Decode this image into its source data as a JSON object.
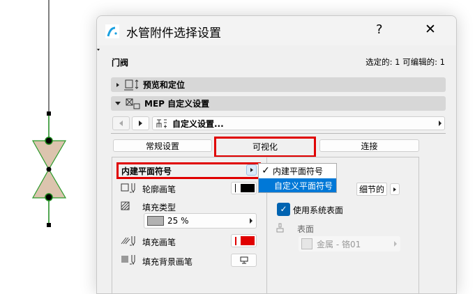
{
  "dialog": {
    "title": "水管附件选择设置",
    "help": "?",
    "close": "✕"
  },
  "header": {
    "element_name": "门阀",
    "selection_info": "选定的: 1 可编辑的: 1"
  },
  "sections": [
    {
      "label": "预览和定位",
      "expanded": false
    },
    {
      "label": "MEP 自定义设置",
      "expanded": true
    }
  ],
  "nav": {
    "dropdown_value": "自定义设置..."
  },
  "tabs": [
    {
      "label": "常规设置"
    },
    {
      "label": "可视化",
      "active": true
    },
    {
      "label": "连接"
    }
  ],
  "symbol": {
    "selected": "内建平面符号",
    "menu": [
      {
        "label": "内建平面符号",
        "checked": true
      },
      {
        "label": "自定义平面符号",
        "highlighted": true
      }
    ]
  },
  "left": {
    "outline_pen": "轮廓画笔",
    "fill_type": "填充类型",
    "fill_type_value": "25 %",
    "fill_pen": "填充画笔",
    "fill_bg_pen": "填充背景画笔"
  },
  "right": {
    "detail_button": "细节的",
    "use_system_surface": "使用系统表面",
    "use_system_surface_checked": true,
    "surface_label": "表面",
    "surface_value": "金属 - 铬01"
  },
  "colors": {
    "accent": "#0078d7",
    "highlight_box": "#e00000",
    "outline_pen": "#000000",
    "fill_pen": "#e00000",
    "valve_fill": "#dcc4ae",
    "valve_stroke": "#2a9a2a"
  }
}
